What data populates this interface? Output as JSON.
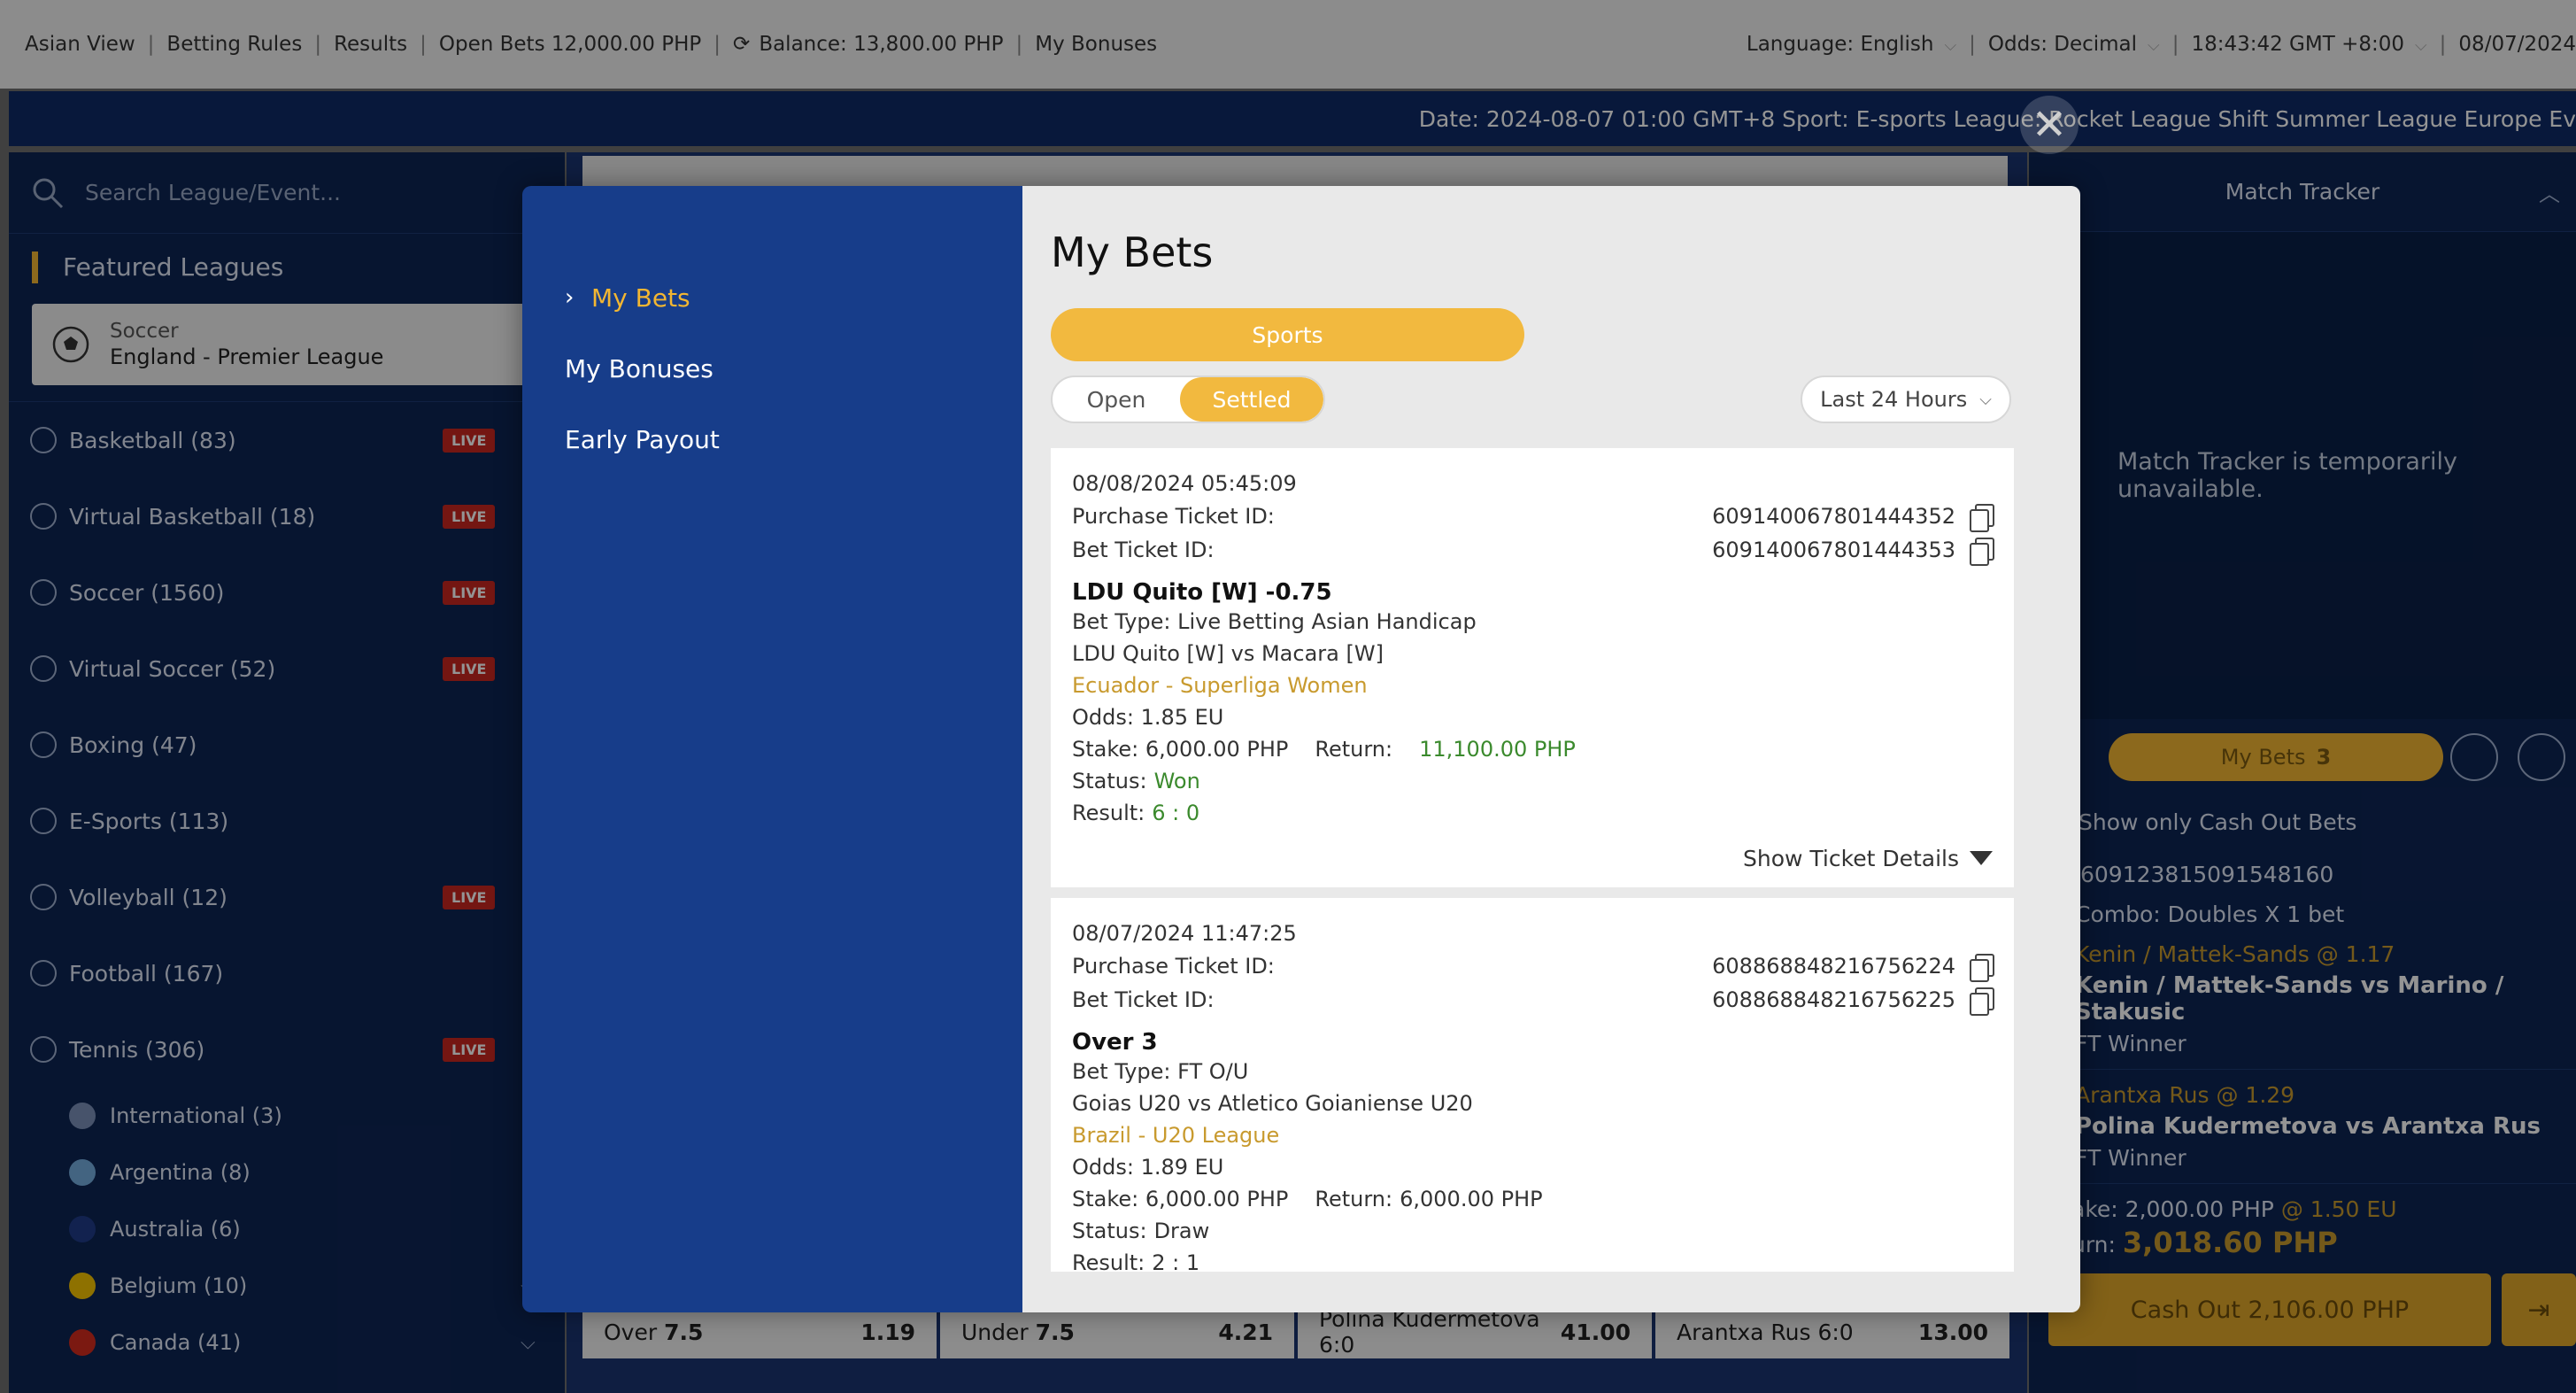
{
  "topbar": {
    "items": [
      "Asian View",
      "Betting Rules",
      "Results",
      "Open Bets 12,000.00 PHP"
    ],
    "balance": "Balance: 13,800.00 PHP",
    "bonuses": "My Bonuses",
    "language": "Language: English",
    "odds": "Odds: Decimal",
    "time": "18:43:42 GMT +8:00",
    "date": "08/07/2024"
  },
  "ticker": "Date: 2024-08-07 01:00 GMT+8 Sport: E-sports League: Rocket League Shift Summer League Europe Ev",
  "sidebar": {
    "search_placeholder": "Search League/Event...",
    "featured_title": "Featured Leagues",
    "featured_sport": "Soccer",
    "featured_league": "England - Premier League",
    "live_label": "LIVE",
    "sports": [
      {
        "label": "Basketball (83)",
        "live": true
      },
      {
        "label": "Virtual Basketball (18)",
        "live": true
      },
      {
        "label": "Soccer (1560)",
        "live": true
      },
      {
        "label": "Virtual Soccer (52)",
        "live": true
      },
      {
        "label": "Boxing (47)",
        "live": false
      },
      {
        "label": "E-Sports (113)",
        "live": false
      },
      {
        "label": "Volleyball (12)",
        "live": true
      },
      {
        "label": "Football (167)",
        "live": false
      },
      {
        "label": "Tennis (306)",
        "live": true
      }
    ],
    "subs": [
      {
        "label": "International (3)",
        "color": "#7a8fb8"
      },
      {
        "label": "Argentina (8)",
        "color": "#74acdf"
      },
      {
        "label": "Australia (6)",
        "color": "#1f3c88"
      },
      {
        "label": "Belgium (10)",
        "color": "#f4c300"
      },
      {
        "label": "Canada (41)",
        "color": "#d52b1e"
      }
    ]
  },
  "odds_rows": [
    [
      {
        "label": "Over",
        "val": "7.5",
        "odds": "1.19"
      },
      {
        "label": "Under",
        "val": "7.5",
        "odds": "4.21"
      },
      {
        "label": "Polina Kudermetova 6:0",
        "val": "",
        "odds": "41.00"
      },
      {
        "label": "Arantxa Rus 6:0",
        "val": "",
        "odds": "13.00"
      }
    ]
  ],
  "right_panel": {
    "title": "Match Tracker",
    "tracker_msg": "Match Tracker is temporarily unavailable.",
    "mybets": "My Bets",
    "mybets_count": "3",
    "cashout_only": "Show only Cash Out Bets",
    "ticket": "609123815091548160",
    "combo": "Combo: Doubles X 1 bet",
    "leg1_pick": "Kenin / Mattek-Sands @ 1.17",
    "leg1_match": "Kenin / Mattek-Sands vs Marino / Stakusic",
    "leg1_market": "FT Winner",
    "leg2_pick": "Arantxa Rus @ 1.29",
    "leg2_match": "Polina Kudermetova vs Arantxa Rus",
    "leg2_market": "FT Winner",
    "stake": "ake: 2,000.00 PHP",
    "stake_odds": "@ 1.50 EU",
    "return_label": "urn:",
    "return_val": "3,018.60 PHP",
    "cashout": "Cash Out 2,106.00 PHP"
  },
  "modal": {
    "nav": [
      {
        "label": "My Bets",
        "active": true
      },
      {
        "label": "My Bonuses",
        "active": false
      },
      {
        "label": "Early Payout",
        "active": false
      }
    ],
    "title": "My Bets",
    "sports_tab": "Sports",
    "open_tab": "Open",
    "settled_tab": "Settled",
    "range": "Last 24 Hours",
    "purchase_label": "Purchase Ticket ID:",
    "bet_label": "Bet Ticket ID:",
    "details_label": "Show Ticket Details",
    "bets": [
      {
        "datetime": "08/08/2024 05:45:09",
        "purchase_id": "609140067801444352",
        "bet_id": "609140067801444353",
        "selection": "LDU Quito [W] -0.75",
        "bet_type": "Bet Type: Live Betting Asian Handicap",
        "match": "LDU Quito [W] vs Macara [W]",
        "league": "Ecuador - Superliga Women",
        "odds": "Odds: 1.85 EU",
        "stake": "Stake: 6,000.00 PHP",
        "return_label": "Return:",
        "return_val": "11,100.00 PHP",
        "status_label": "Status:",
        "status_val": "Won",
        "result_label": "Result:",
        "result_val": "6 : 0"
      },
      {
        "datetime": "08/07/2024 11:47:25",
        "purchase_id": "608868848216756224",
        "bet_id": "608868848216756225",
        "selection": "Over 3",
        "bet_type": "Bet Type: FT O/U",
        "match": "Goias U20 vs Atletico Goianiense U20",
        "league": "Brazil - U20 League",
        "odds": "Odds: 1.89 EU",
        "stake": "Stake: 6,000.00 PHP",
        "return_label": "Return:",
        "return_val": "6,000.00 PHP",
        "status_label": "Status:",
        "status_val": "Draw",
        "result_label": "Result:",
        "result_val": "2 : 1"
      }
    ]
  }
}
